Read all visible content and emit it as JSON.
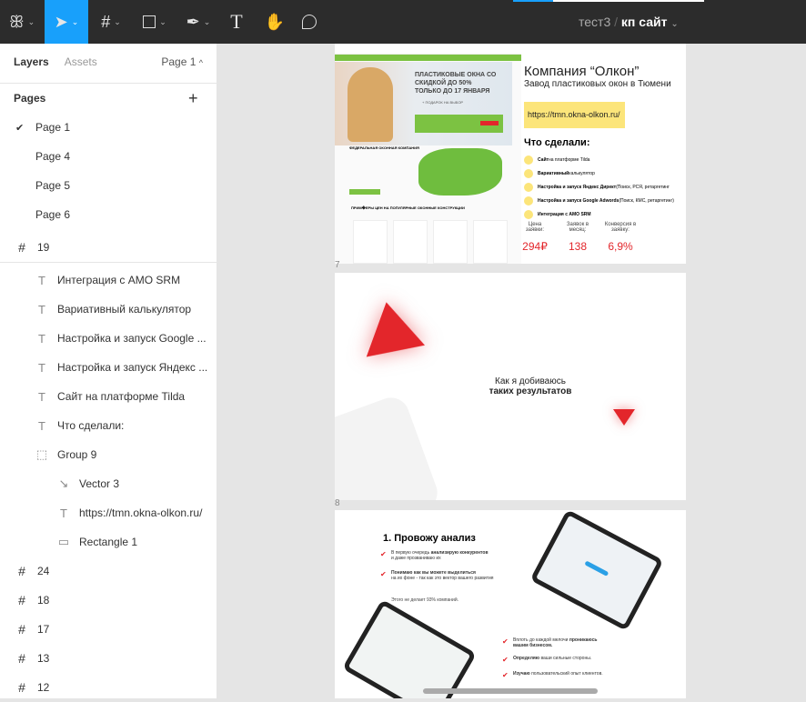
{
  "toolbar": {
    "project": "тест3",
    "separator": "/",
    "file": "кп сайт",
    "chevron": "⌄"
  },
  "panel": {
    "tab_layers": "Layers",
    "tab_assets": "Assets",
    "current_page": "Page 1",
    "pages_title": "Pages",
    "add": "+",
    "pages": [
      {
        "label": "Page 1",
        "selected": true
      },
      {
        "label": "Page 4"
      },
      {
        "label": "Page 5"
      },
      {
        "label": "Page 6"
      }
    ],
    "layers": [
      {
        "icon": "#",
        "label": "19",
        "indent": 0
      },
      {
        "icon": "T",
        "label": "Интеграция с AMO SRM",
        "indent": 1
      },
      {
        "icon": "T",
        "label": "Вариативный калькулятор",
        "indent": 1
      },
      {
        "icon": "T",
        "label": "Настройка и запуск Google ...",
        "indent": 1
      },
      {
        "icon": "T",
        "label": "Настройка и запуск Яндекс ...",
        "indent": 1
      },
      {
        "icon": "T",
        "label": "Сайт на платформе Tilda",
        "indent": 1
      },
      {
        "icon": "T",
        "label": "Что сделали:",
        "indent": 1
      },
      {
        "icon": "⬚",
        "label": "Group 9",
        "indent": 1
      },
      {
        "icon": "↘",
        "label": "Vector 3",
        "indent": 2
      },
      {
        "icon": "T",
        "label": "https://tmn.okna-olkon.ru/",
        "indent": 2
      },
      {
        "icon": "▭",
        "label": "Rectangle 1",
        "indent": 2
      },
      {
        "icon": "#",
        "label": "24",
        "indent": 0
      },
      {
        "icon": "#",
        "label": "18",
        "indent": 0
      },
      {
        "icon": "#",
        "label": "17",
        "indent": 0
      },
      {
        "icon": "#",
        "label": "13",
        "indent": 0
      },
      {
        "icon": "#",
        "label": "12",
        "indent": 0
      }
    ]
  },
  "frames": {
    "f1": {
      "label": "7",
      "promo": "ПЛАСТИКОВЫЕ ОКНА СО СКИДКОЙ ДО 50% ТОЛЬКО ДО 17 ЯНВАРЯ",
      "gift": "+ ПОДАРОК НА ВЫБОР",
      "fed": "ФЕДЕРАЛЬНАЯ ОКОННАЯ КОМПАНИЯ",
      "examples": "ПРИМ�ЕРЫ ЦЕН НА ПОПУЛЯРНЫЕ ОКОННЫЕ КОНСТРУКЦИИ",
      "company": "Компания “Олкон”",
      "subtitle": "Завод пластиковых окон в Тюмени",
      "url": "https://tmn.okna-olkon.ru/",
      "done_title": "Что сделали:",
      "done": [
        {
          "b": "Сайт",
          "t": " на платформе Tilda"
        },
        {
          "b": "Вариативный",
          "t": " калькулятор"
        },
        {
          "b": "Настройка и запуск  Яндекс Директ",
          "t": " (Поиск, РСЯ, ретаргетинг"
        },
        {
          "b": "Настройка и запуск  Google Adwords",
          "t": " (Поиск, КМС, ретаргетинг)"
        },
        {
          "b": "Интеграция с AMO SRM",
          "t": ""
        }
      ],
      "stats": [
        {
          "label": "Цена заявки:",
          "value": "294₽"
        },
        {
          "label": "Заявок в месяц:",
          "value": "138"
        },
        {
          "label": "Конверсия в заявку:",
          "value": "6,9%"
        }
      ]
    },
    "f2": {
      "label": "8",
      "line1": "Как я добиваюсь",
      "line2": "таких результатов"
    },
    "f3": {
      "title": "1. Провожу анализ",
      "items": [
        {
          "t1": "В первую очередь ",
          "b": "анализирую конкурентов",
          "t2": "и даже прозваниваю их"
        },
        {
          "t1": "",
          "b": "Понимаю как вы можете выделиться",
          "t2": "на их фоне - так как это вектор вашего развития"
        }
      ],
      "note": "Этого не делает 93% компаний.",
      "items2": [
        {
          "t": "Вплоть до каждой мелочи ",
          "b": "проникаюсь вашим бизнесом."
        },
        {
          "b": "Определяю",
          "t": " ваши сильные стороны."
        },
        {
          "b": "Изучаю",
          "t": " пользовательский опыт клиентов."
        }
      ]
    }
  }
}
